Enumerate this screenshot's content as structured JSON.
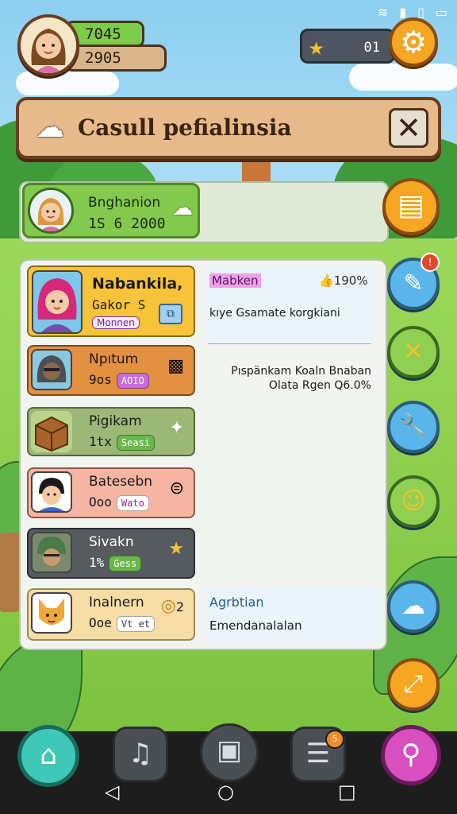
{
  "status_bar": {
    "icons": [
      "wifi-icon",
      "signal-icon",
      "battery-icon",
      "sim-icon"
    ]
  },
  "hud": {
    "currency1": "7045",
    "currency2": "2905",
    "star_count": "01",
    "settings_icon": "gear-icon"
  },
  "banner": {
    "title": "Casull pefialinsia",
    "icon": "ghost-icon",
    "close_label": "✕"
  },
  "profile": {
    "name": "Bnghanion",
    "score": "1S 6 2000"
  },
  "rows": [
    {
      "name": "Nabankila,",
      "sub": "Gakor S",
      "tag": "Monnen"
    },
    {
      "name": "Npıtum",
      "sub": "9os",
      "tag": "AOIO"
    },
    {
      "name": "Pigikam",
      "sub": "1tx",
      "tag": "Seasi"
    },
    {
      "name": "Batesebn",
      "sub": "Ooo",
      "tag": "Wato"
    },
    {
      "name": "Sivakn",
      "sub": "1%",
      "tag": "Gess"
    },
    {
      "name": "Inalnern",
      "sub": "Ooe",
      "tag": "Vt et",
      "extra": "2"
    }
  ],
  "detail_top": {
    "title": "Mabken",
    "percent": "190%",
    "text": "kıye Gsamate korgkiani",
    "text2_line1": "Pıspänkam Koaln Bnaban",
    "text2_line2": "Olata Rgen Q6.0%"
  },
  "detail_bottom": {
    "title": "Agrbtian",
    "text": "Emendanalalan"
  },
  "side_buttons": [
    "shop-icon",
    "pencil-icon",
    "close-icon",
    "wrench-icon",
    "face-icon",
    "map-icon",
    "pickaxe-icon"
  ],
  "nav": {
    "items": [
      "home-icon",
      "music-icon",
      "backpack-icon",
      "list-icon",
      "search-icon"
    ],
    "badge": "5"
  },
  "colors": {
    "accent": "#f5a623",
    "panel": "#f2f4f0"
  }
}
